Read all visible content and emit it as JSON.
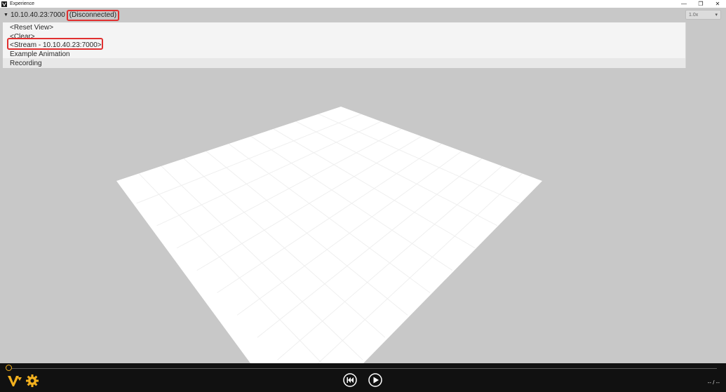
{
  "window": {
    "title": "Experience",
    "minimize_glyph": "—",
    "restore_glyph": "❐",
    "close_glyph": "✕"
  },
  "source": {
    "address": "10.10.40.23:7000",
    "status": "(Disconnected)",
    "speed": "1.0x"
  },
  "dropdown": {
    "items": [
      "<Reset View>",
      "<Clear>",
      "<Stream - 10.10.40.23:7000>",
      "Example Animation",
      "Recording"
    ]
  },
  "playback": {
    "progress": 0,
    "time_readout": "-- / --"
  },
  "colors": {
    "accent": "#f2b01e",
    "highlight_box": "#e03030",
    "viewport_bg": "#c8c8c8",
    "bottom_bar": "#111111"
  },
  "icons": {
    "app": "app-logo-icon",
    "caret": "caret-down-icon",
    "logo": "v-logo-icon",
    "settings": "gear-icon",
    "rewind": "rewind-icon",
    "play": "play-icon"
  }
}
